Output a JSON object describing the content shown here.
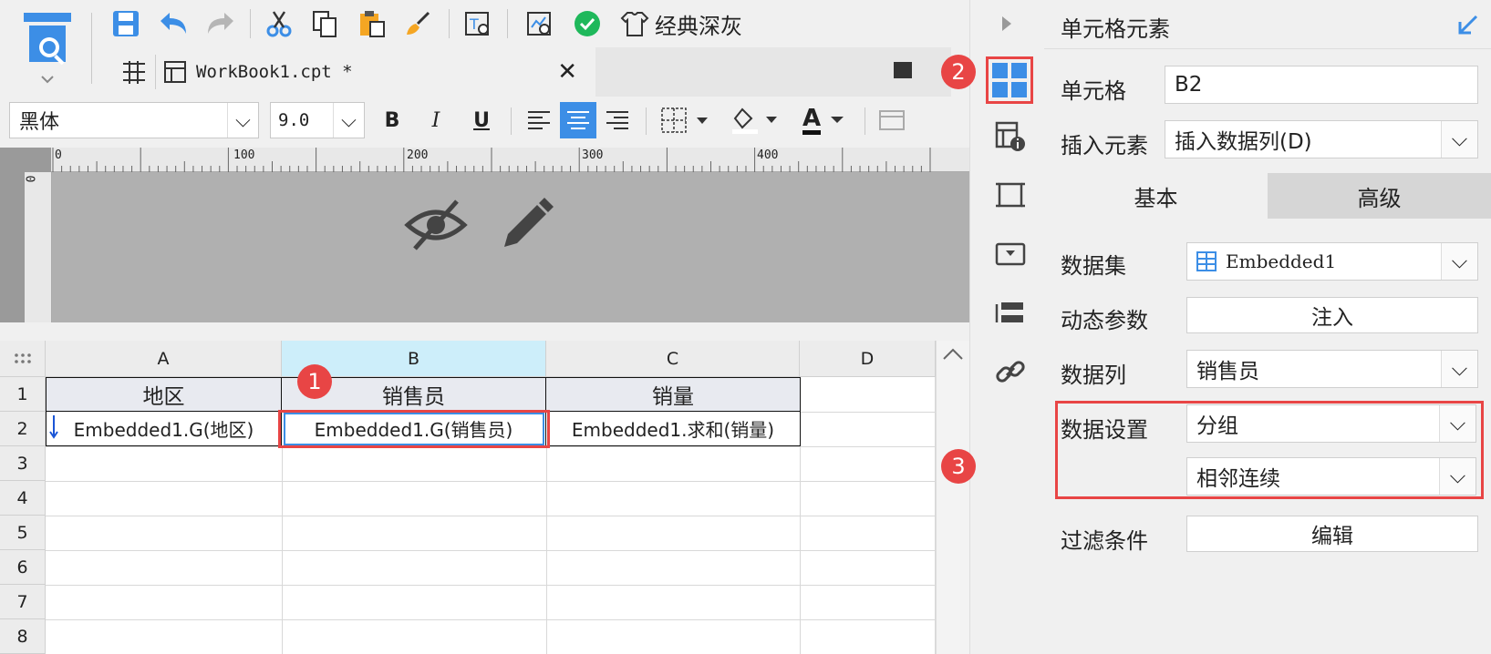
{
  "toolbar": {
    "theme_label": "经典深灰"
  },
  "tab": {
    "filename": "WorkBook1.cpt *"
  },
  "format": {
    "font_name": "黑体",
    "font_size": "9.0",
    "bold": "B",
    "italic": "I",
    "underline": "U",
    "font_color_glyph": "A"
  },
  "ruler": {
    "h_ticks": [
      "0",
      "100",
      "200",
      "300",
      "400"
    ],
    "v_tick": "0"
  },
  "sheet": {
    "columns": [
      "A",
      "B",
      "C",
      "D"
    ],
    "rows": [
      "1",
      "2",
      "3",
      "4",
      "5",
      "6",
      "7",
      "8"
    ],
    "header_row": [
      "地区",
      "销售员",
      "销量"
    ],
    "data_row": [
      "Embedded1.G(地区)",
      "Embedded1.G(销售员)",
      "Embedded1.求和(销量)"
    ]
  },
  "badges": {
    "one": "1",
    "two": "2",
    "three": "3"
  },
  "panel": {
    "title": "单元格元素",
    "cell_label": "单元格",
    "cell_value": "B2",
    "insert_label": "插入元素",
    "insert_value": "插入数据列(D)",
    "tab_basic": "基本",
    "tab_advanced": "高级",
    "dataset_label": "数据集",
    "dataset_value": "Embedded1",
    "dynparam_label": "动态参数",
    "dynparam_button": "注入",
    "column_label": "数据列",
    "column_value": "销售员",
    "setting_label": "数据设置",
    "setting_value": "分组",
    "setting_sub_value": "相邻连续",
    "filter_label": "过滤条件",
    "filter_button": "编辑"
  },
  "colors": {
    "accent_blue": "#3c8ee6",
    "badge_red": "#e84545",
    "selected_col": "#cdeefa"
  }
}
